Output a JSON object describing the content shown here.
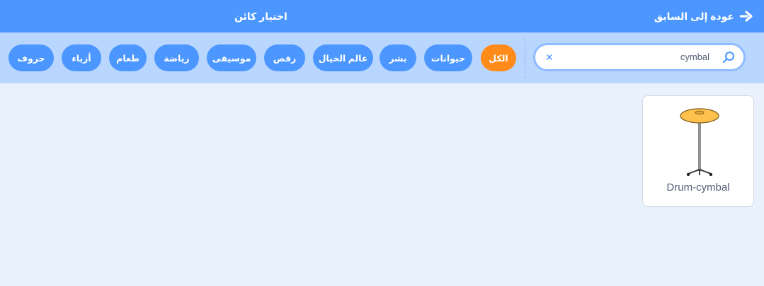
{
  "header": {
    "back_label": "عودة إلى السابق",
    "title": "اختيار كائن"
  },
  "search": {
    "value": "cymbal",
    "clear_symbol": "✕"
  },
  "tags": [
    "الكل",
    "حيوانات",
    "بشر",
    "عالم الخيال",
    "رقص",
    "موسيقى",
    "رياضة",
    "طعام",
    "أزياء",
    "حروف"
  ],
  "active_tag": "الكل",
  "sprites": [
    {
      "name": "Drum-cymbal"
    }
  ],
  "colors": {
    "header": "#4c97ff",
    "filter_bar": "#b9d6ff",
    "active_tag": "#ff8c1a",
    "tag": "#4c97ff",
    "background": "#e9f1fc"
  },
  "icons": {
    "back": "arrow-left-icon",
    "search": "magnifier-icon",
    "clear": "close-icon"
  }
}
